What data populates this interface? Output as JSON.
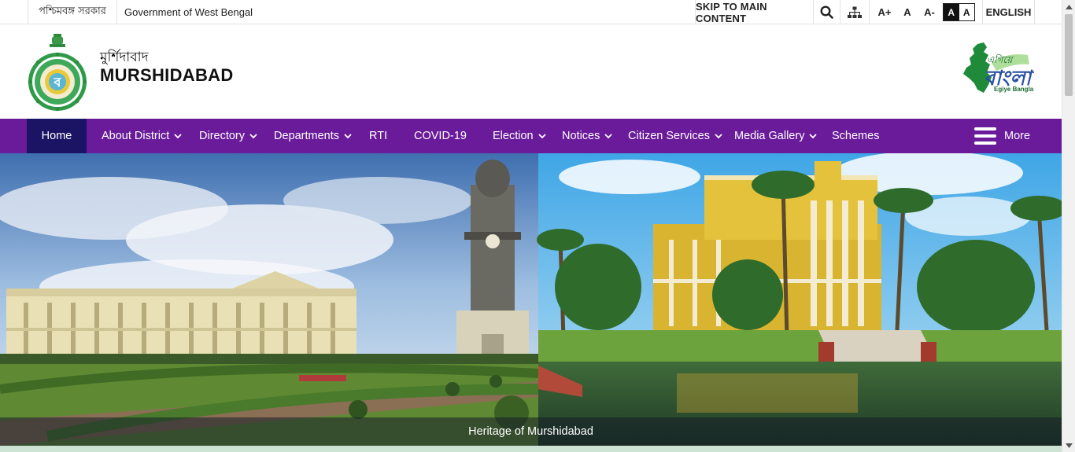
{
  "topbar": {
    "state_bn": "পশ্চিমবঙ্গ সরকার",
    "government": "Government of West Bengal",
    "skip": "SKIP TO MAIN CONTENT",
    "font_increase": "A+",
    "font_normal": "A",
    "font_decrease": "A-",
    "contrast_dark": "A",
    "contrast_light": "A",
    "language": "ENGLISH",
    "search_icon": "search-icon",
    "sitemap_icon": "sitemap-icon"
  },
  "header": {
    "district_bn": "মুর্শিদাবাদ",
    "district_en": "MURSHIDABAD",
    "emblem_icon": "west-bengal-emblem",
    "partner_logo_text": "Egiye Bangla"
  },
  "nav": {
    "items": [
      {
        "label": "Home",
        "has_dropdown": false
      },
      {
        "label": "About District",
        "has_dropdown": true
      },
      {
        "label": "Directory",
        "has_dropdown": true
      },
      {
        "label": "Departments",
        "has_dropdown": true
      },
      {
        "label": "RTI",
        "has_dropdown": false
      },
      {
        "label": "COVID-19",
        "has_dropdown": false
      },
      {
        "label": "Election",
        "has_dropdown": true
      },
      {
        "label": "Notices",
        "has_dropdown": true
      },
      {
        "label": "Citizen Services",
        "has_dropdown": true
      },
      {
        "label": "Media Gallery",
        "has_dropdown": true
      },
      {
        "label": "Schemes",
        "has_dropdown": false
      }
    ],
    "more": "More"
  },
  "banner": {
    "caption": "Heritage of Murshidabad"
  },
  "colors": {
    "nav_bg": "#6a1b9a",
    "nav_active": "#1b1464",
    "brand_green": "#1a6b2f"
  }
}
